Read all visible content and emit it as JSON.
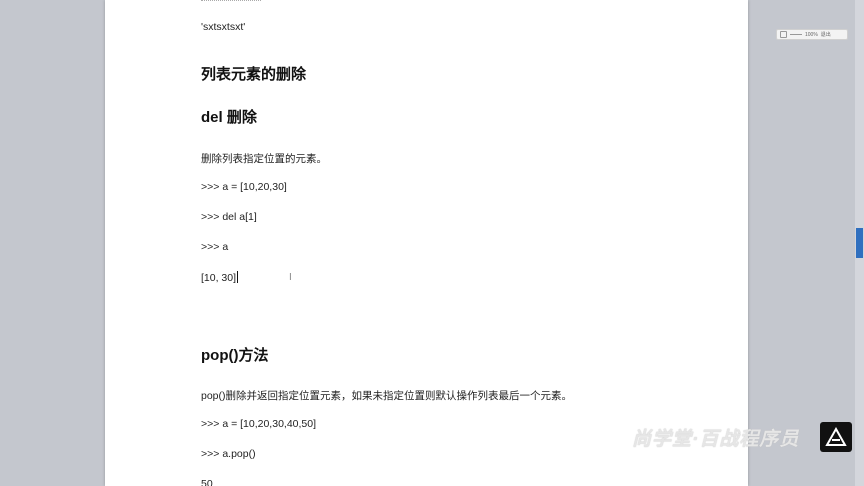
{
  "document": {
    "string_result": "'sxtsxtsxt'",
    "section_heading": "列表元素的删除",
    "del_heading": "del  删除",
    "del_desc": "删除列表指定位置的元素。",
    "del_code": [
      ">>> a = [10,20,30]",
      ">>> del a[1]",
      ">>> a",
      "[10, 30]"
    ],
    "pop_heading": "pop()方法",
    "pop_desc": "pop()删除并返回指定位置元素，如果未指定位置则默认操作列表最后一个元素。",
    "pop_code": [
      ">>> a = [10,20,30,40,50]",
      ">>> a.pop()",
      "50"
    ]
  },
  "zoom_control": {
    "zoom_level": "100%",
    "exit_label": "退出"
  },
  "watermark": {
    "text": "尚学堂·百战程序员"
  },
  "icons": {
    "caret": "text-caret",
    "ibeam": "ibeam-cursor-icon",
    "logo": "brand-logo-icon",
    "scrollbar": "vertical-scrollbar"
  }
}
